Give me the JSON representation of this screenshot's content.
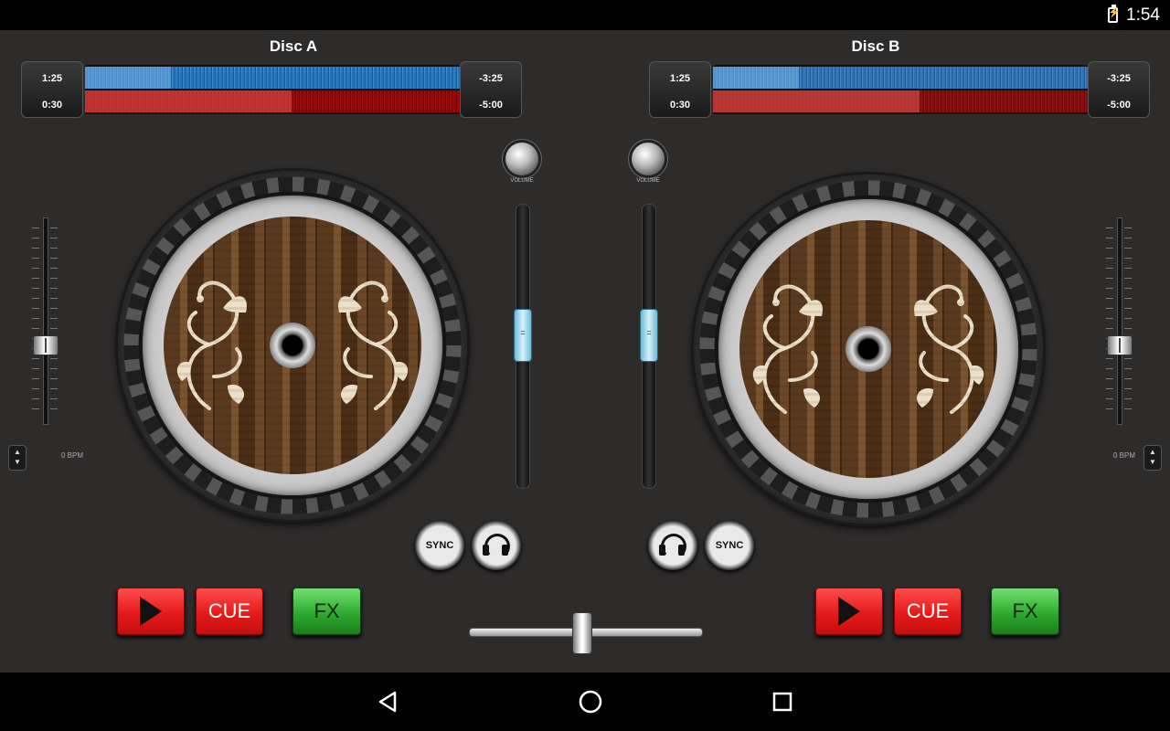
{
  "status_bar": {
    "time": "1:54",
    "battery_icon": "battery-charging-icon"
  },
  "deck_a": {
    "title": "Disc A",
    "time_left_top": "1:25",
    "time_left_bottom": "0:30",
    "time_right_top": "-3:25",
    "time_right_bottom": "-5:00",
    "bpm": "0 BPM",
    "pitch_level": 0.37,
    "volume_level": 0.55,
    "progress_top": 0.23,
    "progress_bottom": 0.55
  },
  "deck_b": {
    "title": "Disc B",
    "time_left_top": "1:25",
    "time_left_bottom": "0:30",
    "time_right_top": "-3:25",
    "time_right_bottom": "-5:00",
    "bpm": "0 BPM",
    "pitch_level": 0.37,
    "volume_level": 0.55,
    "progress_top": 0.23,
    "progress_bottom": 0.55
  },
  "mixer": {
    "volume_label": "VOLUME",
    "sync_label": "SYNC",
    "crossfader_level": 0.48
  },
  "buttons": {
    "cue_label": "CUE",
    "fx_label": "FX"
  },
  "nav": {
    "back_icon": "back-triangle-icon",
    "home_icon": "home-circle-icon",
    "recents_icon": "recents-square-icon"
  },
  "colors": {
    "background": "#2e2b2b",
    "button_red": "#e51a1a",
    "button_green": "#2faa2f",
    "wave_blue": "#2b72b5",
    "wave_red": "#8a0a0a",
    "fader_cyan": "#a8dff0"
  }
}
